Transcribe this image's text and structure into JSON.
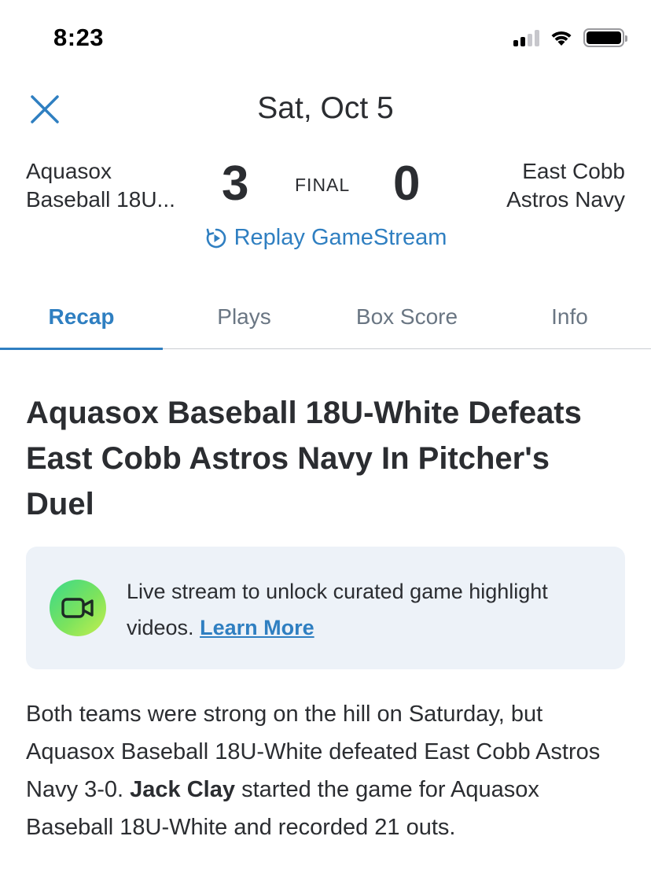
{
  "status_bar": {
    "time": "8:23"
  },
  "header": {
    "title": "Sat, Oct 5"
  },
  "scoreboard": {
    "home_team_line1": "Aquasox",
    "home_team_line2": "Baseball 18U...",
    "home_score": "3",
    "status": "FINAL",
    "away_score": "0",
    "away_team_line1": "East Cobb",
    "away_team_line2": "Astros Navy",
    "replay_label": "Replay GameStream"
  },
  "tabs": [
    {
      "label": "Recap",
      "active": true
    },
    {
      "label": "Plays",
      "active": false
    },
    {
      "label": "Box Score",
      "active": false
    },
    {
      "label": "Info",
      "active": false
    }
  ],
  "article": {
    "headline": "Aquasox Baseball 18U-White Defeats East Cobb Astros Navy In Pitcher's Duel",
    "promo_text": "Live stream to unlock curated game highlight videos.",
    "promo_link": "Learn More",
    "body_part1": "Both teams were strong on the hill on Saturday, but Aquasox Baseball 18U-White defeated East Cobb Astros Navy 3-0.",
    "body_bold": "Jack Clay",
    "body_part2": "started the game for Aquasox Baseball 18U-White and recorded 21 outs."
  },
  "colors": {
    "accent": "#2f7fc1",
    "text": "#2b2d31",
    "tab_inactive": "#6a7683",
    "promo_bg": "#edf2f8"
  },
  "icons": {
    "close": "close-icon",
    "replay": "replay-icon",
    "video": "video-camera-icon"
  }
}
